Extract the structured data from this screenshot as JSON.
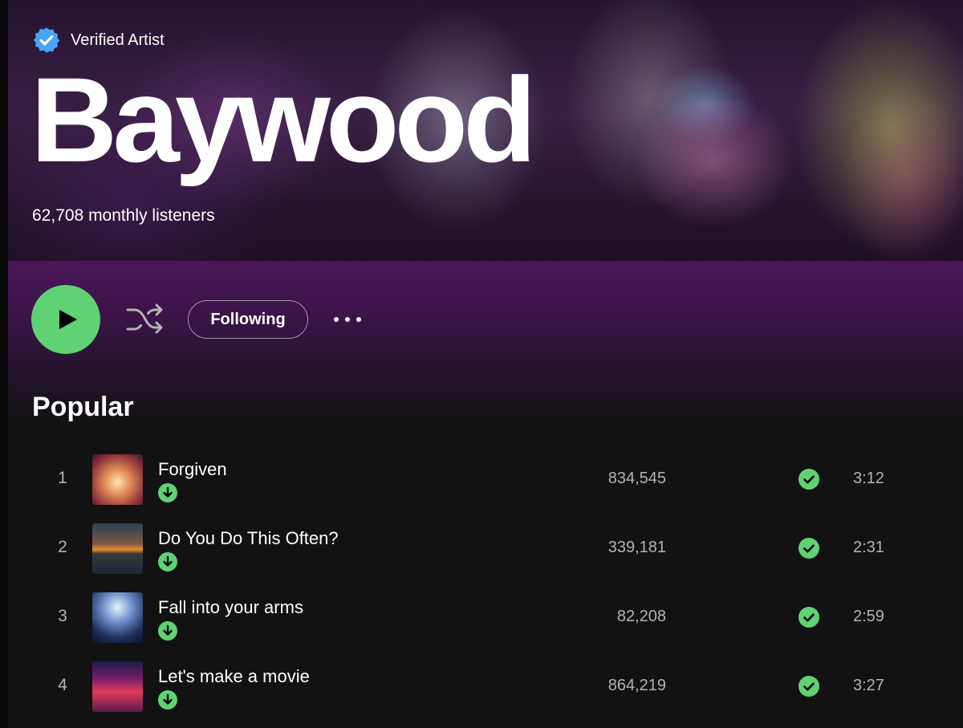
{
  "artist": {
    "verified_label": "Verified Artist",
    "name": "Baywood",
    "monthly_listeners": "62,708 monthly listeners"
  },
  "controls": {
    "follow_label": "Following"
  },
  "popular": {
    "title": "Popular",
    "tracks": [
      {
        "rank": "1",
        "title": "Forgiven",
        "plays": "834,545",
        "duration": "3:12"
      },
      {
        "rank": "2",
        "title": "Do You Do This Often?",
        "plays": "339,181",
        "duration": "2:31"
      },
      {
        "rank": "3",
        "title": "Fall into your arms",
        "plays": "82,208",
        "duration": "2:59"
      },
      {
        "rank": "4",
        "title": "Let's make a movie",
        "plays": "864,219",
        "duration": "3:27"
      }
    ]
  },
  "colors": {
    "accent_green": "#1ed760",
    "verified_blue": "#4aa3f5",
    "background": "#121212",
    "header_purple": "#4a1658"
  },
  "icons": {
    "verified": "verified-badge-icon",
    "play": "play-icon",
    "shuffle": "shuffle-icon",
    "more": "more-options-icon",
    "downloaded": "download-arrow-icon",
    "saved": "check-circle-icon"
  }
}
